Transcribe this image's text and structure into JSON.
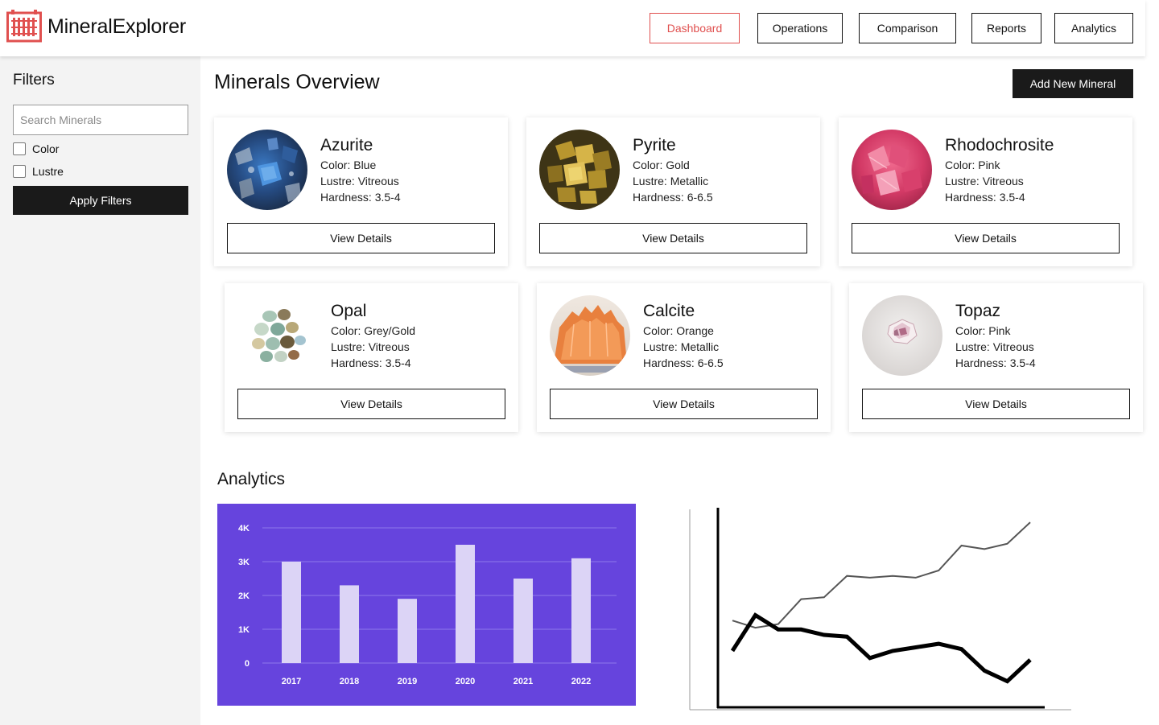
{
  "app": {
    "name": "MineralExplorer",
    "logo_icon": "building-grid-icon",
    "brand_color": "#e0504f"
  },
  "nav": {
    "items": [
      {
        "label": "Dashboard",
        "active": true
      },
      {
        "label": "Operations",
        "active": false
      },
      {
        "label": "Comparison",
        "active": false
      },
      {
        "label": "Reports",
        "active": false
      },
      {
        "label": "Analytics",
        "active": false
      }
    ]
  },
  "sidebar": {
    "title": "Filters",
    "search_placeholder": "Search Minerals",
    "checkboxes": [
      {
        "label": "Color",
        "checked": false
      },
      {
        "label": "Lustre",
        "checked": false
      }
    ],
    "apply_label": "Apply Filters"
  },
  "main": {
    "title": "Minerals Overview",
    "add_label": "Add New Mineral",
    "details_label": "View Details",
    "minerals": [
      {
        "name": "Azurite",
        "color": "Color: Blue",
        "lustre": "Lustre: Vitreous",
        "hardness": "Hardness: 3.5-4",
        "image": "azurite-crystal-photo"
      },
      {
        "name": "Pyrite",
        "color": "Color: Gold",
        "lustre": "Lustre: Metallic",
        "hardness": "Hardness: 6-6.5",
        "image": "pyrite-crystal-photo"
      },
      {
        "name": "Rhodochrosite",
        "color": "Color: Pink",
        "lustre": "Lustre: Vitreous",
        "hardness": "Hardness: 3.5-4",
        "image": "rhodochrosite-crystal-photo"
      },
      {
        "name": "Opal",
        "color": "Color: Grey/Gold",
        "lustre": "Lustre: Vitreous",
        "hardness": "Hardness: 3.5-4",
        "image": "opal-stones-photo"
      },
      {
        "name": "Calcite",
        "color": "Color: Orange",
        "lustre": "Lustre: Metallic",
        "hardness": "Hardness: 6-6.5",
        "image": "calcite-crystal-photo"
      },
      {
        "name": "Topaz",
        "color": "Color: Pink",
        "lustre": "Lustre: Vitreous",
        "hardness": "Hardness: 3.5-4",
        "image": "topaz-gem-photo"
      }
    ]
  },
  "analytics": {
    "title": "Analytics"
  },
  "chart_data": [
    {
      "type": "bar",
      "title": "",
      "xlabel": "",
      "ylabel": "",
      "categories": [
        "2017",
        "2018",
        "2019",
        "2020",
        "2021",
        "2022"
      ],
      "values": [
        3000,
        2300,
        1900,
        3500,
        2500,
        3100
      ],
      "ylim": [
        0,
        4000
      ],
      "yticks": [
        0,
        1000,
        2000,
        3000,
        4000
      ],
      "ytick_labels": [
        "0",
        "1K",
        "2K",
        "3K",
        "4K"
      ],
      "grid": true,
      "background": "#6644dd",
      "bar_color": "#dcd4f6"
    },
    {
      "type": "line",
      "title": "",
      "xlabel": "",
      "ylabel": "",
      "x": [
        0,
        1,
        2,
        3,
        4,
        5,
        6,
        7,
        8,
        9,
        10,
        11,
        12,
        13,
        14
      ],
      "ylim": [
        0,
        100
      ],
      "series": [
        {
          "values": [
            40,
            36,
            38,
            52,
            53,
            65,
            64,
            65,
            64,
            68,
            82,
            80,
            83,
            95,
            null
          ],
          "color": "#555555",
          "width": 2
        },
        {
          "values": [
            23,
            43,
            35,
            35,
            32,
            31,
            19,
            23,
            25,
            27,
            24,
            12,
            6,
            18,
            null
          ],
          "color": "#000000",
          "width": 5
        }
      ]
    }
  ]
}
